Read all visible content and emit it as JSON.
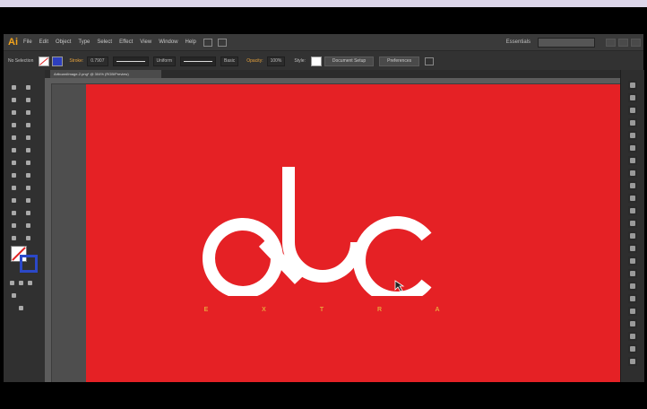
{
  "app": {
    "logo": "Ai",
    "workspace": "Essentials"
  },
  "menu": [
    "File",
    "Edit",
    "Object",
    "Type",
    "Select",
    "Effect",
    "View",
    "Window",
    "Help"
  ],
  "control_bar": {
    "selection_label": "No Selection",
    "stroke_label": "Stroke:",
    "stroke_value": "0.7907",
    "stroke_profile": "Uniform",
    "brush": "Basic",
    "opacity_label": "Opacity:",
    "opacity_value": "100%",
    "style_label": "Style:",
    "document_setup": "Document Setup",
    "preferences": "Preferences"
  },
  "document": {
    "tab_title": "ArtboardImage-2.png* @ 304% (RGB/Preview)"
  },
  "artwork": {
    "wordmark": "abc",
    "tagline": [
      "E",
      "X",
      "T",
      "R",
      "A"
    ]
  },
  "colors": {
    "artboard": "#e52125",
    "tagline": "#e8a33c",
    "logo": "#ffffff"
  }
}
